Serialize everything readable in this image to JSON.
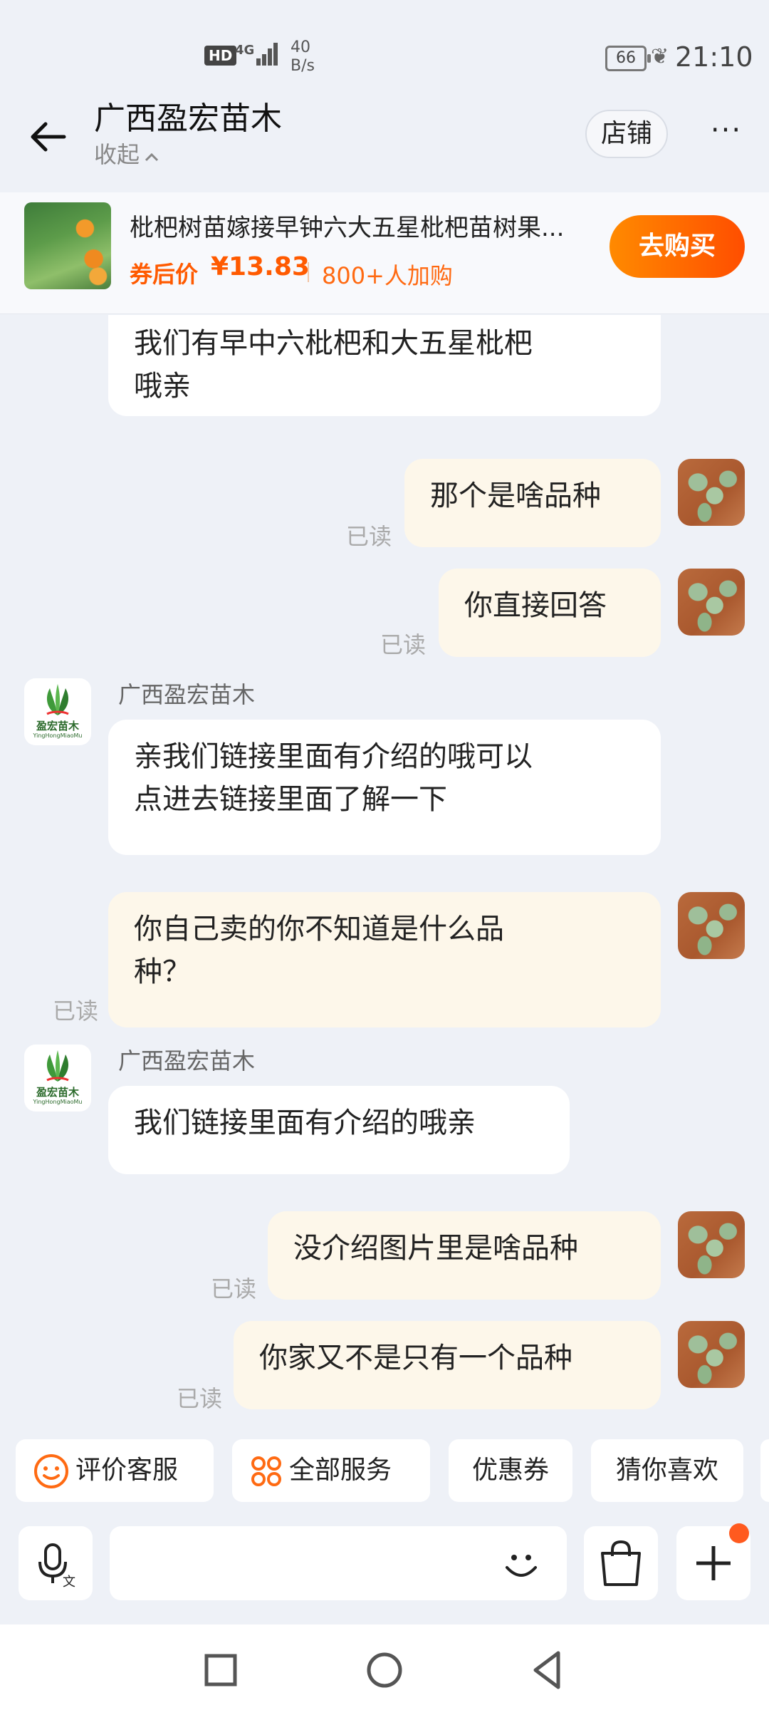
{
  "status_bar": {
    "hd": "HD",
    "network": "4G",
    "speed_value": "40",
    "speed_unit": "B/s",
    "battery": "66",
    "time": "21:10"
  },
  "header": {
    "title": "广西盈宏苗木",
    "collapse_label": "收起",
    "store_button": "店铺",
    "more_label": "···"
  },
  "product": {
    "name": "枇杷树苗嫁接早钟六大五星枇杷苗树果...",
    "price_label": "券后价",
    "price": "¥13.83",
    "buyers": "800+人加购",
    "buy_button": "去购买"
  },
  "shop_avatar": {
    "name_text": "盈宏苗木",
    "pinyin": "YingHongMiaoMu"
  },
  "messages": [
    {
      "from": "shop",
      "text_line1": "我们有早中六枇杷和大五星枇杷",
      "text_line2": "哦亲"
    },
    {
      "from": "user",
      "text": "那个是啥品种",
      "status": "已读"
    },
    {
      "from": "user",
      "text": "你直接回答",
      "status": "已读"
    },
    {
      "from": "shop",
      "sender": "广西盈宏苗木",
      "text_line1": "亲我们链接里面有介绍的哦可以",
      "text_line2": "点进去链接里面了解一下"
    },
    {
      "from": "user",
      "text_line1": "你自己卖的你不知道是什么品",
      "text_line2": "种？",
      "status": "已读"
    },
    {
      "from": "shop",
      "sender": "广西盈宏苗木",
      "text": "我们链接里面有介绍的哦亲"
    },
    {
      "from": "user",
      "text": "没介绍图片里是啥品种",
      "status": "已读"
    },
    {
      "from": "user",
      "text": "你家又不是只有一个品种",
      "status": "已读"
    }
  ],
  "quick_actions": [
    {
      "label": "评价客服",
      "icon": "smiley-icon"
    },
    {
      "label": "全部服务",
      "icon": "grid-icon"
    },
    {
      "label": "优惠券"
    },
    {
      "label": "猜你喜欢"
    }
  ],
  "input": {
    "placeholder": ""
  },
  "colors": {
    "accent": "#ff5a00",
    "background": "#eef1f7",
    "outgoing_bubble": "#fdf7ea",
    "incoming_bubble": "#ffffff"
  }
}
